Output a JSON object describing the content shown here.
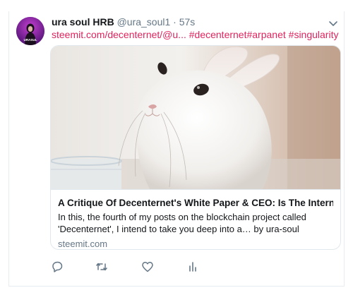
{
  "tweet": {
    "display_name": "ura soul HRB",
    "handle": "@ura_soul1",
    "separator": "·",
    "time": "57s",
    "text_link": "steemit.com/decenternet/@u...",
    "hashtags": [
      "#decenternet",
      "#arpanet",
      "#singularity"
    ]
  },
  "avatar": {
    "label": "URASUL"
  },
  "card": {
    "title": "A Critique Of Decenternet's White Paper & CEO: Is The Internet For C...",
    "description": "In this, the fourth of my posts on the blockchain project called 'Decenternet', I intend to take you deep into a… by ura-soul",
    "domain": "steemit.com"
  },
  "actions": {
    "icons": [
      "reply-icon",
      "retweet-icon",
      "like-icon",
      "analytics-icon"
    ]
  },
  "colors": {
    "link": "#e0245e",
    "secondary_text": "#657786",
    "icon": "#657786",
    "avatar_bg": "#7a2aa8"
  }
}
